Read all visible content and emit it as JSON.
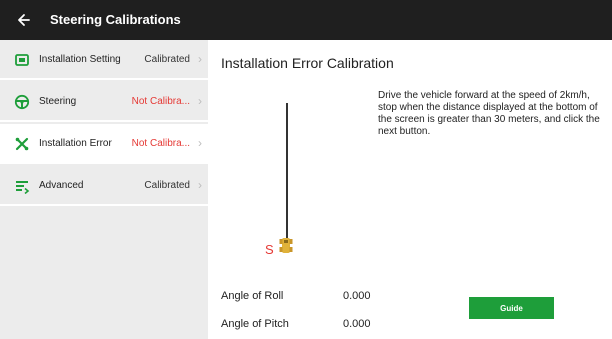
{
  "header": {
    "title": "Steering Calibrations",
    "back_icon": "arrow-left-icon"
  },
  "sidebar": {
    "items": [
      {
        "label": "Installation Setting",
        "status": "Calibrated",
        "status_kind": "ok",
        "icon": "installation-setting-icon"
      },
      {
        "label": "Steering",
        "status": "Not Calibra...",
        "status_kind": "bad",
        "icon": "steering-wheel-icon"
      },
      {
        "label": "Installation Error",
        "status": "Not Calibra...",
        "status_kind": "bad",
        "icon": "installation-error-icon",
        "active": true
      },
      {
        "label": "Advanced",
        "status": "Calibrated",
        "status_kind": "ok",
        "icon": "advanced-icon"
      }
    ]
  },
  "main": {
    "title": "Installation Error Calibration",
    "instructions": "Drive the vehicle forward at the speed of 2km/h, stop when the distance displayed at the bottom of the screen is greater than 30 meters, and click the next button.",
    "start_marker": "S",
    "readings": [
      {
        "label": "Angle of Roll",
        "value": "0.000"
      },
      {
        "label": "Angle of Pitch",
        "value": "0.000"
      }
    ],
    "guide_button": "Guide"
  },
  "colors": {
    "header_bg": "#1f1f1f",
    "sidebar_bg": "#ececec",
    "icon_green": "#1e9e3a",
    "status_red": "#e53935",
    "vehicle_yellow": "#e0b23a"
  }
}
